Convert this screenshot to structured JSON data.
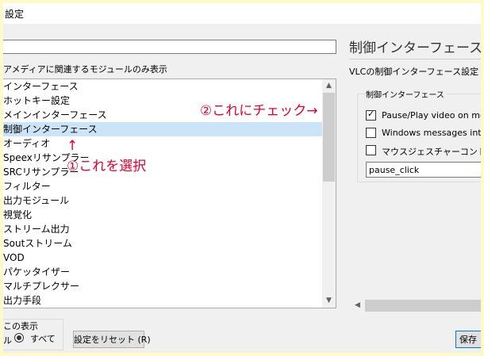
{
  "window": {
    "title": "設定"
  },
  "filter": {
    "value": "",
    "hint": "アメディアに関連するモジュールのみ表示"
  },
  "module_list": {
    "items": [
      {
        "label": "インターフェース",
        "selected": false
      },
      {
        "label": "ホットキー設定",
        "selected": false
      },
      {
        "label": "メインインターフェース",
        "selected": false
      },
      {
        "label": "制御インターフェース",
        "selected": true
      },
      {
        "label": "オーディオ",
        "selected": false
      },
      {
        "label": "Speexリサンプラー",
        "selected": false
      },
      {
        "label": "SRCリサンプラー",
        "selected": false
      },
      {
        "label": "フィルター",
        "selected": false
      },
      {
        "label": "出力モジュール",
        "selected": false
      },
      {
        "label": "視覚化",
        "selected": false
      },
      {
        "label": "ストリーム出力",
        "selected": false
      },
      {
        "label": "Soutストリーム",
        "selected": false
      },
      {
        "label": "VOD",
        "selected": false
      },
      {
        "label": "パケッタイザー",
        "selected": false
      },
      {
        "label": "マルチプレクサー",
        "selected": false
      },
      {
        "label": "出力手段",
        "selected": false
      }
    ]
  },
  "show_settings": {
    "label": "この表示",
    "simple_label": "ル",
    "all_label": "すべて",
    "all_selected": true
  },
  "buttons": {
    "reset": "設定をリセット (R)",
    "save": "保存"
  },
  "panel": {
    "title": "制御インターフェース",
    "subtitle": "VLCの制御インターフェース設定",
    "group_label": "制御インターフェース",
    "checkboxes": [
      {
        "label": "Pause/Play video on mouse click",
        "checked": true
      },
      {
        "label": "Windows messages interface",
        "checked": false
      },
      {
        "label": "マウスジェスチャーコントロールインターフェース",
        "checked": false
      }
    ],
    "text_field_value": "pause_click"
  },
  "annotations": {
    "select": "①これを選択",
    "up_arrow": "↑",
    "check": "②これにチェック→"
  },
  "icons": {
    "check": "check-icon",
    "scroll_up": "chevron-up-icon",
    "scroll_down": "chevron-down-icon",
    "scroll_left": "chevron-left-icon"
  },
  "colors": {
    "annotation": "#e4002b",
    "selection": "#cce4f7",
    "frame": "#fffbc8"
  }
}
